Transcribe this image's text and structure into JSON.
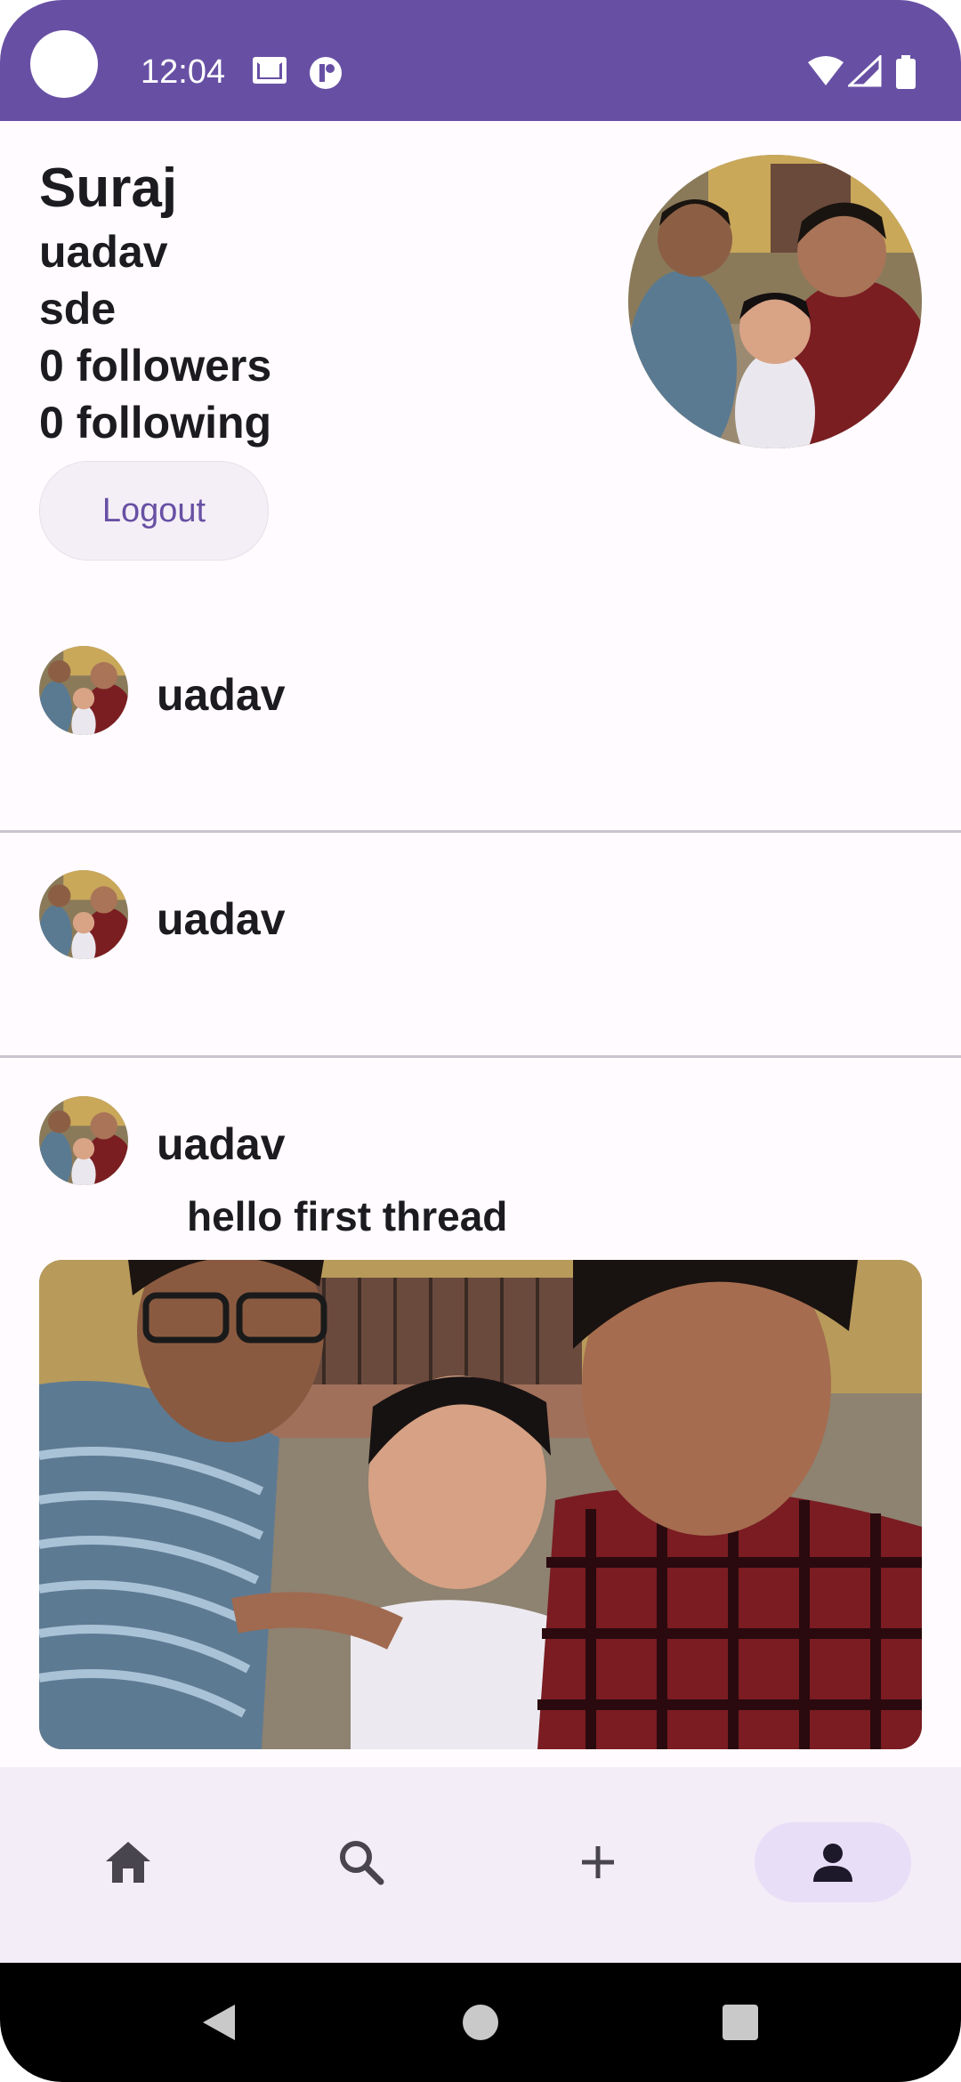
{
  "status_bar": {
    "time": "12:04",
    "background_color": "#6750a4",
    "icons": [
      "mail-icon",
      "app-notification-icon",
      "wifi-icon",
      "signal-icon",
      "battery-icon"
    ]
  },
  "profile": {
    "name": "Suraj",
    "username": "uadav",
    "bio": "sde",
    "followers": "0 followers",
    "following": "0 following",
    "logout_label": "Logout"
  },
  "threads": [
    {
      "username": "uadav",
      "text": ""
    },
    {
      "username": "uadav",
      "text": ""
    },
    {
      "username": "uadav",
      "text": "hello first thread",
      "has_image": true
    }
  ],
  "bottom_nav": {
    "items": [
      {
        "icon": "home-icon",
        "selected": false
      },
      {
        "icon": "search-icon",
        "selected": false
      },
      {
        "icon": "add-icon",
        "selected": false
      },
      {
        "icon": "person-icon",
        "selected": true
      }
    ],
    "selected_color": "#e8def8"
  },
  "accent_color": "#6750a4"
}
